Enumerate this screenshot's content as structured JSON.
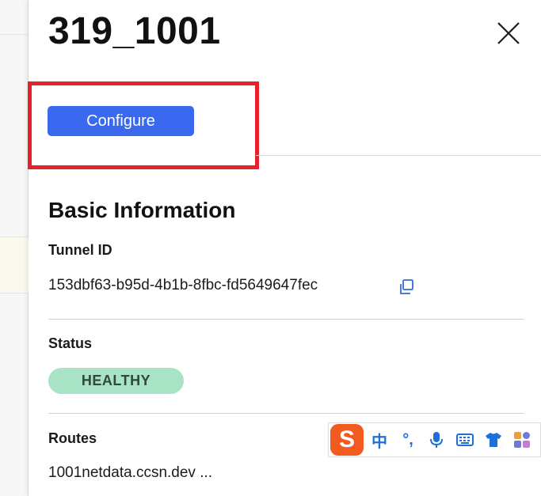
{
  "panel": {
    "title": "319_1001",
    "configure_label": "Configure"
  },
  "basic_info": {
    "heading": "Basic Information",
    "tunnel_id_label": "Tunnel ID",
    "tunnel_id_value": "153dbf63-b95d-4b1b-8fbc-fd5649647fec",
    "status_label": "Status",
    "status_value": "HEALTHY",
    "routes_label": "Routes",
    "routes_value": "1001netdata.ccsn.dev ..."
  },
  "ime_toolbar": {
    "logo_text": "S",
    "mode_label": "中",
    "punct_label": "°,",
    "icons": [
      "sogou-logo-icon",
      "microphone-icon",
      "keyboard-icon",
      "shirt-icon",
      "apps-grid-icon"
    ]
  },
  "colors": {
    "accent": "#3a68ee",
    "highlight": "#e8202a",
    "status_healthy": "#a7e3c4",
    "ime_brand": "#f25a1f",
    "ime_icon": "#1f6fd8"
  }
}
